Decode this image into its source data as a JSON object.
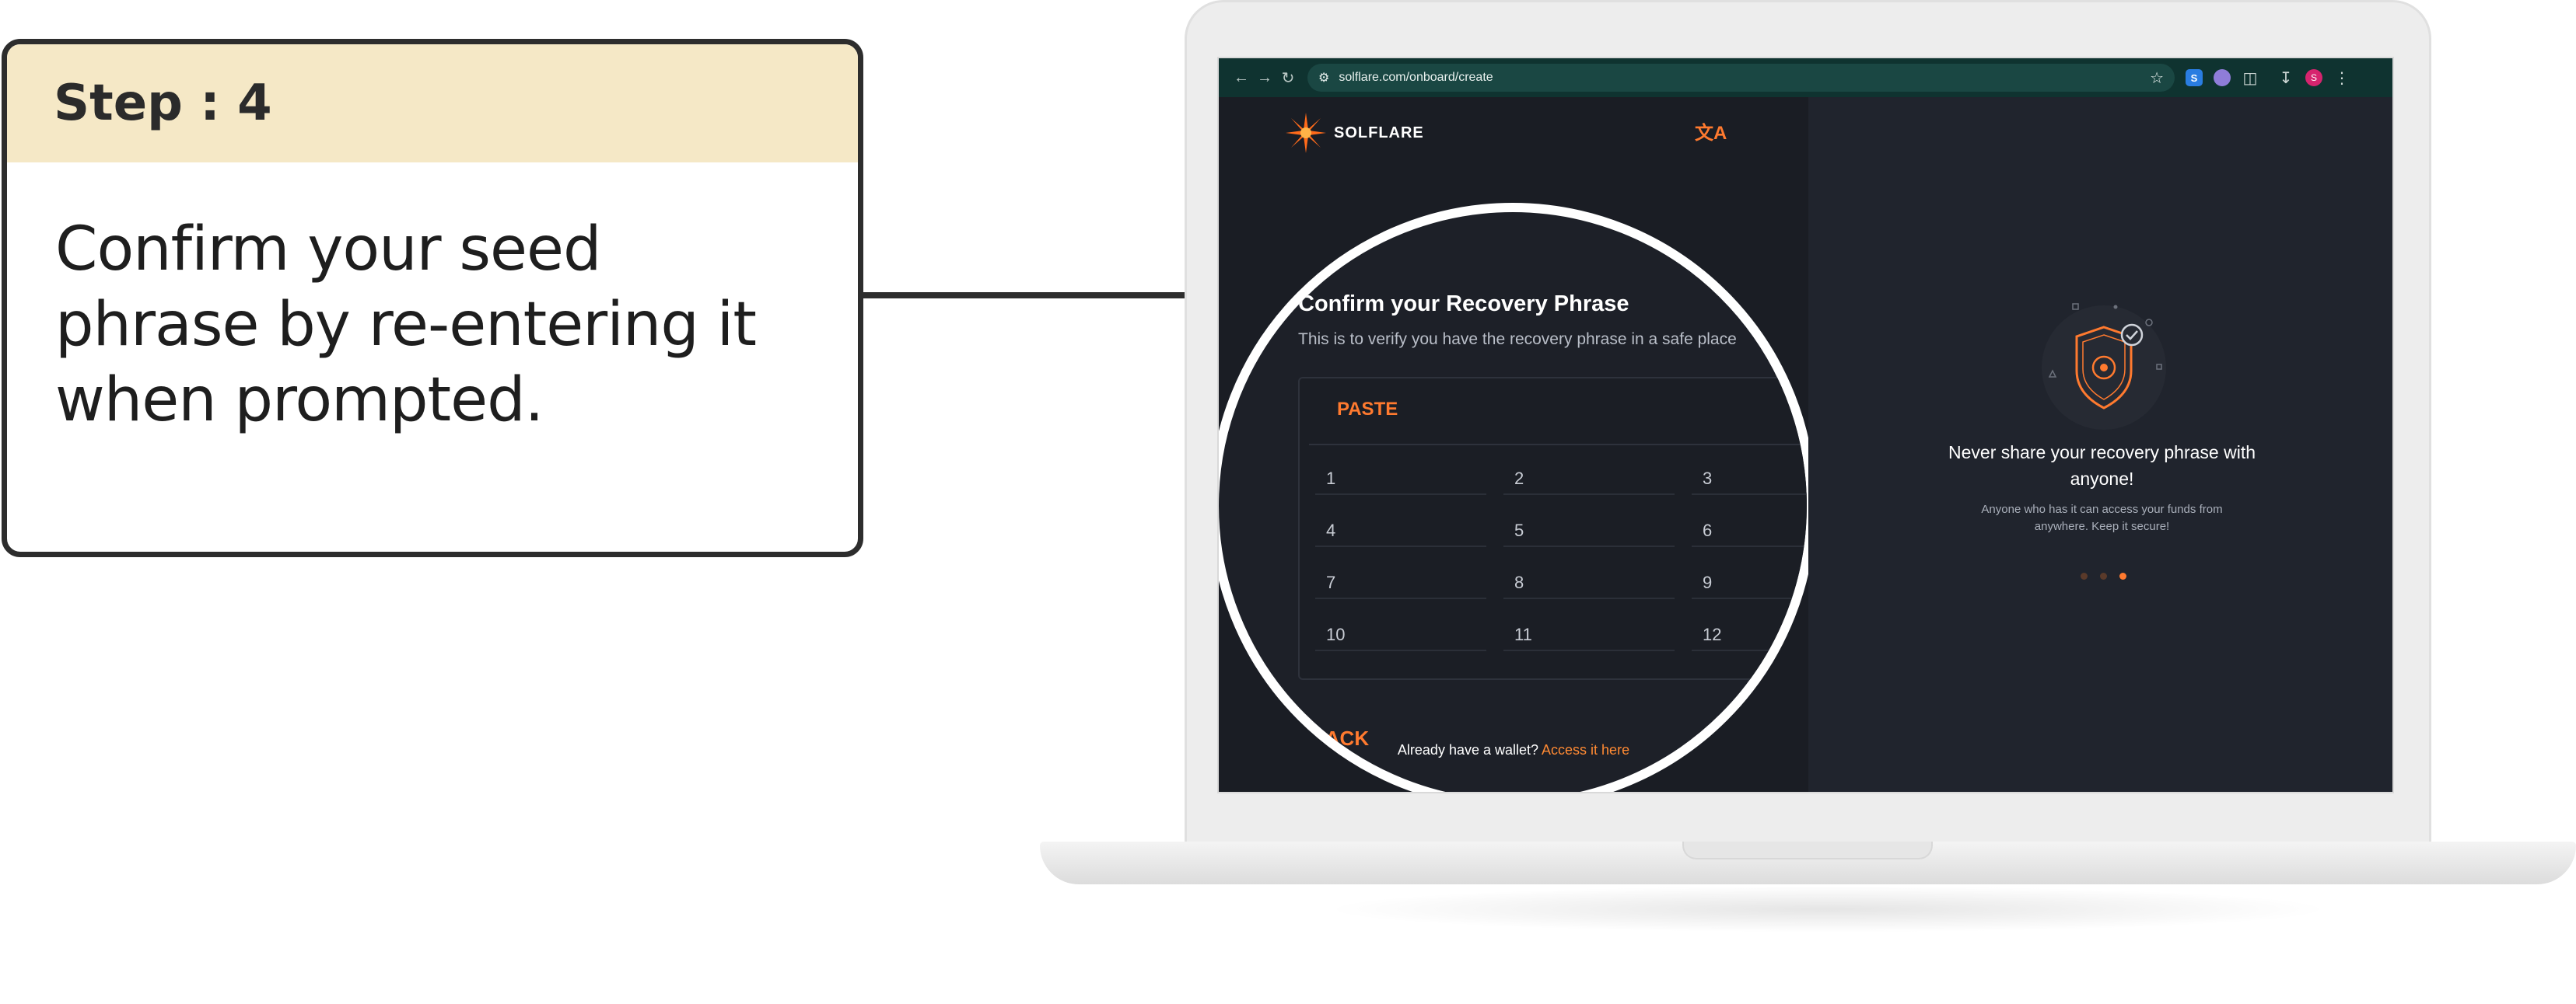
{
  "callout": {
    "step_label": "Step : 4",
    "instruction": "Confirm your seed phrase by re-entering it when prompted."
  },
  "browser": {
    "url": "solflare.com/onboard/create",
    "avatar_letter": "S",
    "ext_letter": "S"
  },
  "app": {
    "brand": "SOLFLARE",
    "title": "Confirm your Recovery Phrase",
    "subtitle": "This is to verify you have the recovery phrase in a safe place",
    "paste_label": "PASTE",
    "word_slots": [
      "1",
      "2",
      "3",
      "4",
      "5",
      "6",
      "7",
      "8",
      "9",
      "10",
      "11",
      "12"
    ],
    "back_label": "BACK",
    "footer_text": "Already have a wallet?",
    "footer_link": "Access it here"
  },
  "info_panel": {
    "title": "Never share your recovery phrase with anyone!",
    "subtitle": "Anyone who has it can access your funds from anywhere. Keep it secure!",
    "carousel_total": 3,
    "carousel_active": 3
  },
  "colors": {
    "accent": "#ff7a2f",
    "callout_header": "#f5e8c6",
    "browser_bar": "#0f3330",
    "app_bg": "#1a1d24"
  }
}
